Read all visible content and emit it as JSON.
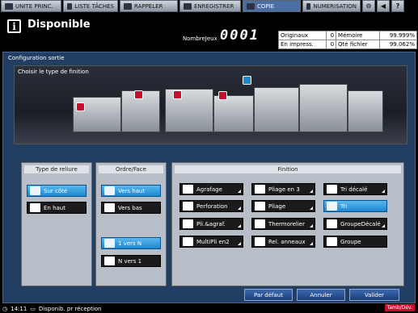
{
  "tabs": [
    {
      "label": "UNITE PRINC.",
      "icon": "home-icon"
    },
    {
      "label": "LISTE TÂCHES",
      "icon": "list-icon"
    },
    {
      "label": "RAPPELER",
      "icon": "recall-icon"
    },
    {
      "label": "ENREGISTRER",
      "icon": "save-icon"
    },
    {
      "label": "COPIE",
      "icon": "copy-icon",
      "active": true
    },
    {
      "label": "NUMERISATION",
      "icon": "scan-icon"
    }
  ],
  "header": {
    "status": "Disponible",
    "jobs_label": "NombreJeux",
    "jobs_value": "0001"
  },
  "counters": {
    "originals_label": "Originaux",
    "originals_value": "0",
    "memory_label": "Mémoire",
    "memory_value": "99.999%",
    "inprint_label": "En impress.",
    "inprint_value": "0",
    "qfile_label": "Qté fichier",
    "qfile_value": "99.062%"
  },
  "main": {
    "title": "Configuration sortie",
    "scene_label": "Choisir le type de finition"
  },
  "reliure": {
    "title": "Type de reliure",
    "options": [
      {
        "label": "Sur côté",
        "selected": true
      },
      {
        "label": "En haut",
        "selected": false
      }
    ]
  },
  "ordre": {
    "title": "Ordre/Face",
    "options": [
      {
        "label": "Vers haut",
        "selected": true
      },
      {
        "label": "Vers bas",
        "selected": false
      },
      {
        "label": "1 vers N",
        "selected": true
      },
      {
        "label": "N vers 1",
        "selected": false
      }
    ]
  },
  "finition": {
    "title": "Finition",
    "buttons": [
      {
        "label": "Agrafage",
        "selected": false
      },
      {
        "label": "Pliage en 3",
        "selected": false
      },
      {
        "label": "Tri décalé",
        "selected": false
      },
      {
        "label": "Perforation",
        "selected": false
      },
      {
        "label": "Pliage",
        "selected": false
      },
      {
        "label": "Tri",
        "selected": true
      },
      {
        "label": "Pli.&agraf.",
        "selected": false
      },
      {
        "label": "Thermorelier",
        "selected": false
      },
      {
        "label": "GroupeDécalé",
        "selected": false
      },
      {
        "label": "MultiPli en2",
        "selected": false
      },
      {
        "label": "Rel. anneaux",
        "selected": false
      },
      {
        "label": "Groupe",
        "selected": false
      }
    ]
  },
  "actions": {
    "default_label": "Par défaut",
    "cancel_label": "Annuler",
    "ok_label": "Valider"
  },
  "footer": {
    "time": "14:11",
    "status": "Disponib. pr réception",
    "toner": "Tamb/Dév."
  }
}
